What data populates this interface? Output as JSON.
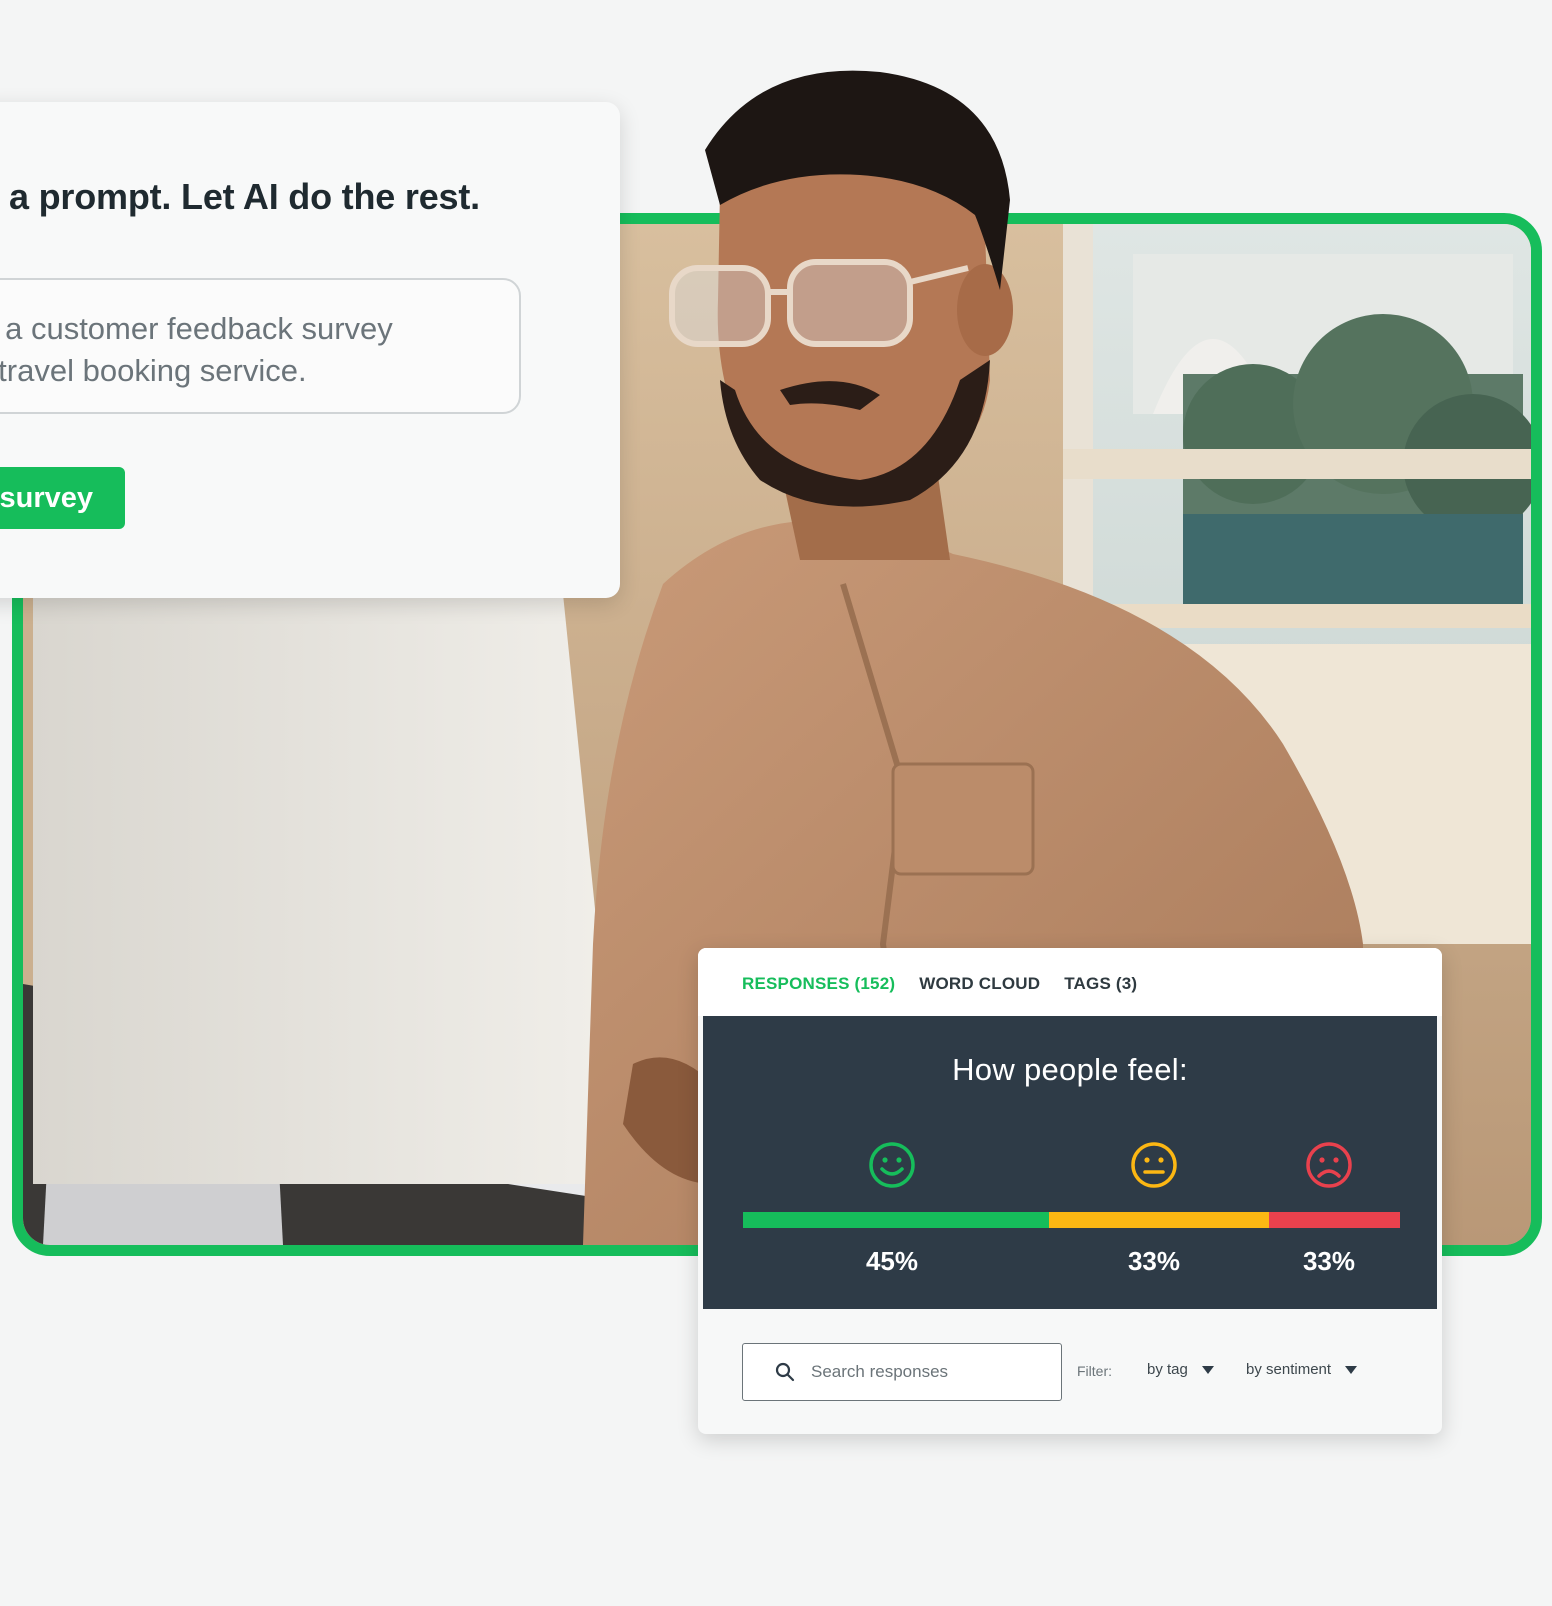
{
  "prompt_card": {
    "title": "rite a prompt. Let AI do the rest.",
    "input_line_1": "ed a customer feedback survey",
    "input_line_2": "ur travel booking service.",
    "button_label": "survey"
  },
  "results_card": {
    "tabs": [
      {
        "label": "RESPONSES (152)",
        "active": true
      },
      {
        "label": "WORD CLOUD",
        "active": false
      },
      {
        "label": "TAGS (3)",
        "active": false
      }
    ],
    "heading": "How people feel:",
    "sentiments": [
      {
        "icon": "happy-face-icon",
        "percent_label": "45%",
        "color": "#16bd5b",
        "bar_share": 0.466
      },
      {
        "icon": "neutral-face-icon",
        "percent_label": "33%",
        "color": "#fcb713",
        "bar_share": 0.334
      },
      {
        "icon": "sad-face-icon",
        "percent_label": "33%",
        "color": "#e9414d",
        "bar_share": 0.2
      }
    ],
    "search": {
      "placeholder": "Search responses"
    },
    "filter": {
      "label": "Filter:",
      "by_tag": "by tag",
      "by_sentiment": "by sentiment"
    }
  },
  "colors": {
    "brand_green": "#16bd5b",
    "dark_panel": "#2e3b47",
    "background": "#f4f5f5"
  }
}
